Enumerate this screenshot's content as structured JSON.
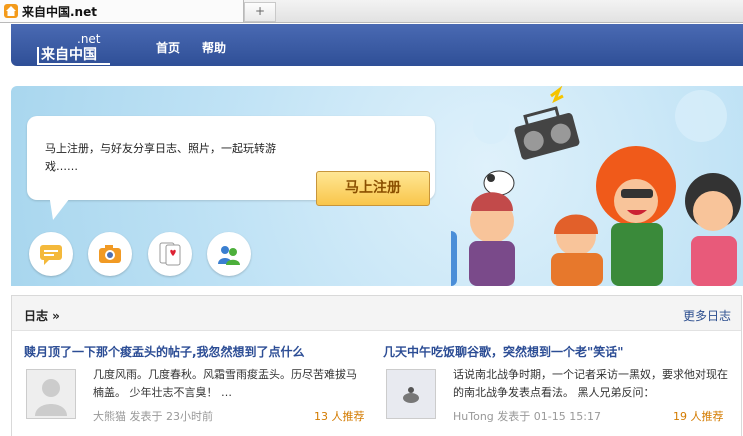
{
  "browser": {
    "tab_title": "来自中国.net",
    "new_tab": "+"
  },
  "header": {
    "logo_net": ".net",
    "logo_cn": "来自中国",
    "nav": [
      {
        "label": "首页"
      },
      {
        "label": "帮助"
      }
    ]
  },
  "banner": {
    "text": "马上注册，与好友分享日志、照片，一起玩转游戏……",
    "register_label": "马上注册",
    "feature_icons": [
      "speech-bubble-icon",
      "camera-icon",
      "playing-card-icon",
      "friends-icon"
    ]
  },
  "log": {
    "title": "日志 »",
    "more": "更多日志",
    "posts": [
      {
        "title": "赎月顶了一下那个痠盂头的帖子,我忽然想到了点什么",
        "excerpt": "几度风雨。几度春秋。风霜雪雨痠盂头。历尽苦难拔马楠盖。 少年壮志不言臭！ …",
        "author": "大熊猫",
        "time": "发表于 23小时前",
        "recommend": "13 人推荐"
      },
      {
        "title": "几天中午吃饭聊谷歌，突然想到一个老\"笑话\"",
        "excerpt": "话说南北战争时期，一个记者采访一黑奴，要求他对现在的南北战争发表点看法。 黑人兄弟反问：",
        "author": "HuTong",
        "time": "发表于 01-15 15:17",
        "recommend": "19 人推荐"
      }
    ]
  }
}
